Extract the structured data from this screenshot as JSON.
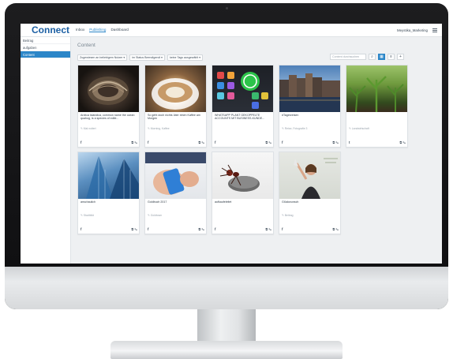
{
  "app": {
    "logo": "Connect",
    "nav": [
      "Inbox",
      "Publishing",
      "Dashboard"
    ],
    "active_nav": "Publishing",
    "user": "Meystika_Marketing"
  },
  "sidebar": {
    "items": [
      {
        "label": "Beitrag"
      },
      {
        "label": "aufgaben"
      },
      {
        "label": "Content"
      }
    ]
  },
  "main": {
    "title": "Content",
    "filters": [
      "Zugewiesen an beliebigem Nutzer",
      "im Status Beendigendi",
      "keine Tags ausgewählt"
    ],
    "search_placeholder": "Content durchsuchen"
  },
  "cards": [
    {
      "caption": "Arctica islandica, common name the ocean quahog, is a species of edibl...",
      "tag": "Mal notiert",
      "net": "f",
      "image": "shell"
    },
    {
      "caption": "So geht doch nichts über einen Kaffee am Morgen",
      "tag": "Morning, Kaffee",
      "net": "f",
      "image": "coffee"
    },
    {
      "caption": "WHATSAPP PLANT GEKOPPELTE ACCOUNTS MIT BUSINESS-KUNDE...",
      "tag": "",
      "net": "f",
      "image": "phone"
    },
    {
      "caption": "#Tagesreisen",
      "tag": "Reise, Fotografie 3",
      "net": "f",
      "image": "city"
    },
    {
      "caption": "",
      "tag": "Landwirtschaft",
      "net": "t",
      "image": "plants"
    },
    {
      "caption": "anschaulich",
      "tag": "Stadtbild",
      "net": "f",
      "image": "glass"
    },
    {
      "caption": "Goldbuch 2017",
      "tag": "Goldtown",
      "net": "f",
      "image": "hands"
    },
    {
      "caption": "aufkaufeleitet",
      "tag": "",
      "net": "f",
      "image": "ant"
    },
    {
      "caption": "Glückwunsch",
      "tag": "Beitrag",
      "net": "f",
      "image": "woman"
    }
  ],
  "icons": {
    "card_action_copy": "copy-icon",
    "card_action_edit": "pencil-icon",
    "search": "search-icon",
    "view_grid": "grid-icon",
    "view_list": "list-icon",
    "add": "plus-icon",
    "menu": "hamburger-icon"
  },
  "colors": {
    "accent": "#2b86c8",
    "logo": "#1b5fa3",
    "background": "#eef0f2"
  }
}
